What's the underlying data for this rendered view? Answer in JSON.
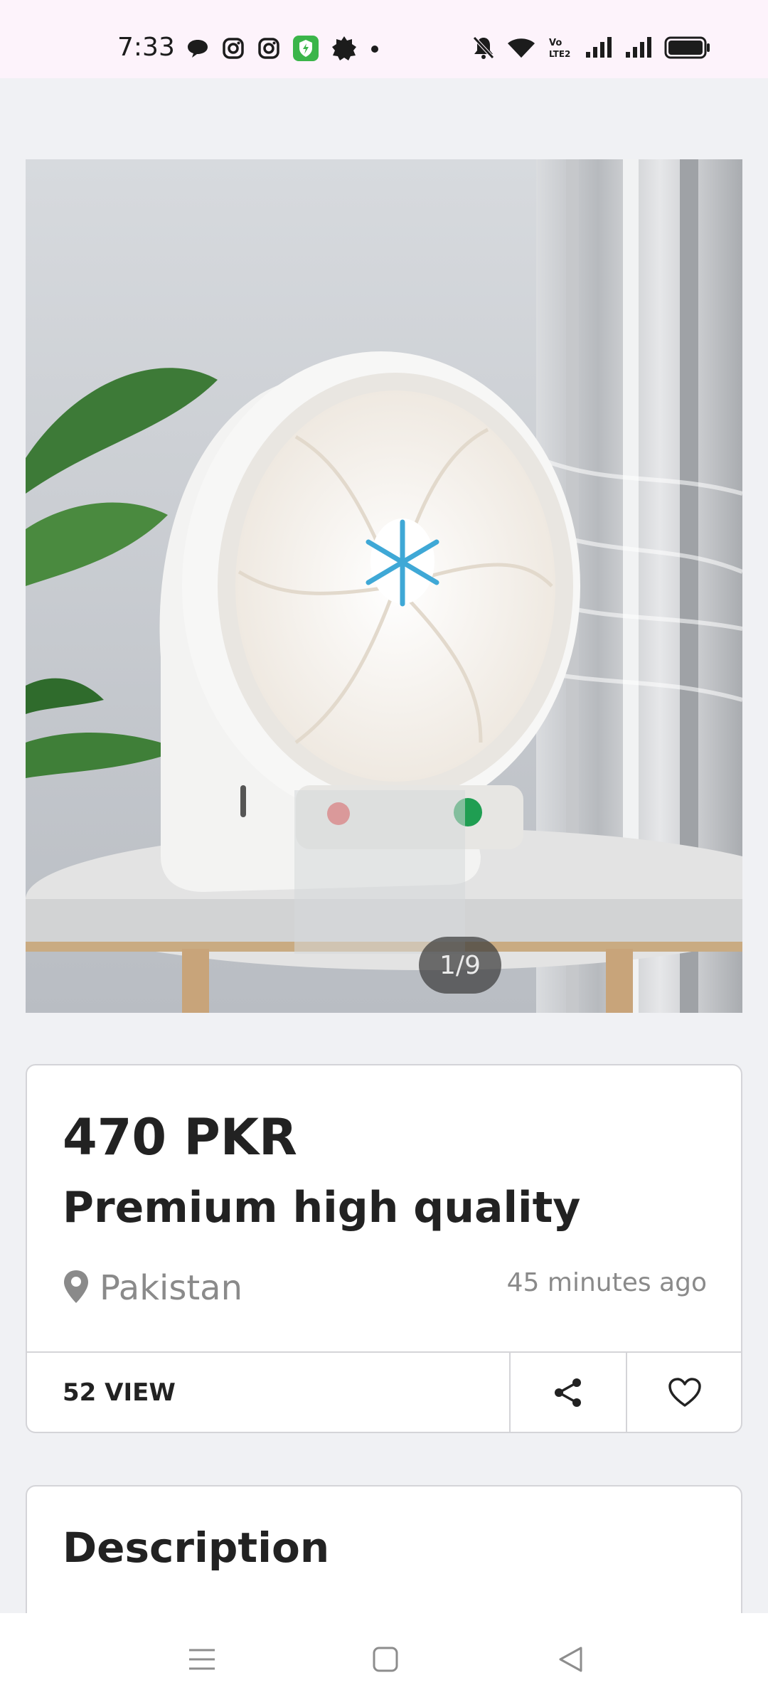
{
  "status_bar": {
    "time": "7:33",
    "left_icons": [
      "chat-bubble-icon",
      "instagram-icon",
      "instagram-icon",
      "shield-app-icon",
      "brightness-icon",
      "dot-icon"
    ],
    "right_icons": [
      "mute-icon",
      "wifi-icon",
      "volte-icon",
      "signal-icon",
      "signal-icon",
      "battery-icon"
    ]
  },
  "gallery": {
    "counter": "1/9"
  },
  "listing": {
    "price": "470 PKR",
    "title": "Premium high quality",
    "location": "Pakistan",
    "posted": "45 minutes ago",
    "views": "52 VIEW"
  },
  "description": {
    "heading": "Description"
  },
  "colors": {
    "background": "#f0f1f4",
    "status_bar": "#fdf3fb",
    "text_primary": "#222222",
    "text_secondary": "#8a8a8a",
    "border": "#d4d4d8"
  }
}
